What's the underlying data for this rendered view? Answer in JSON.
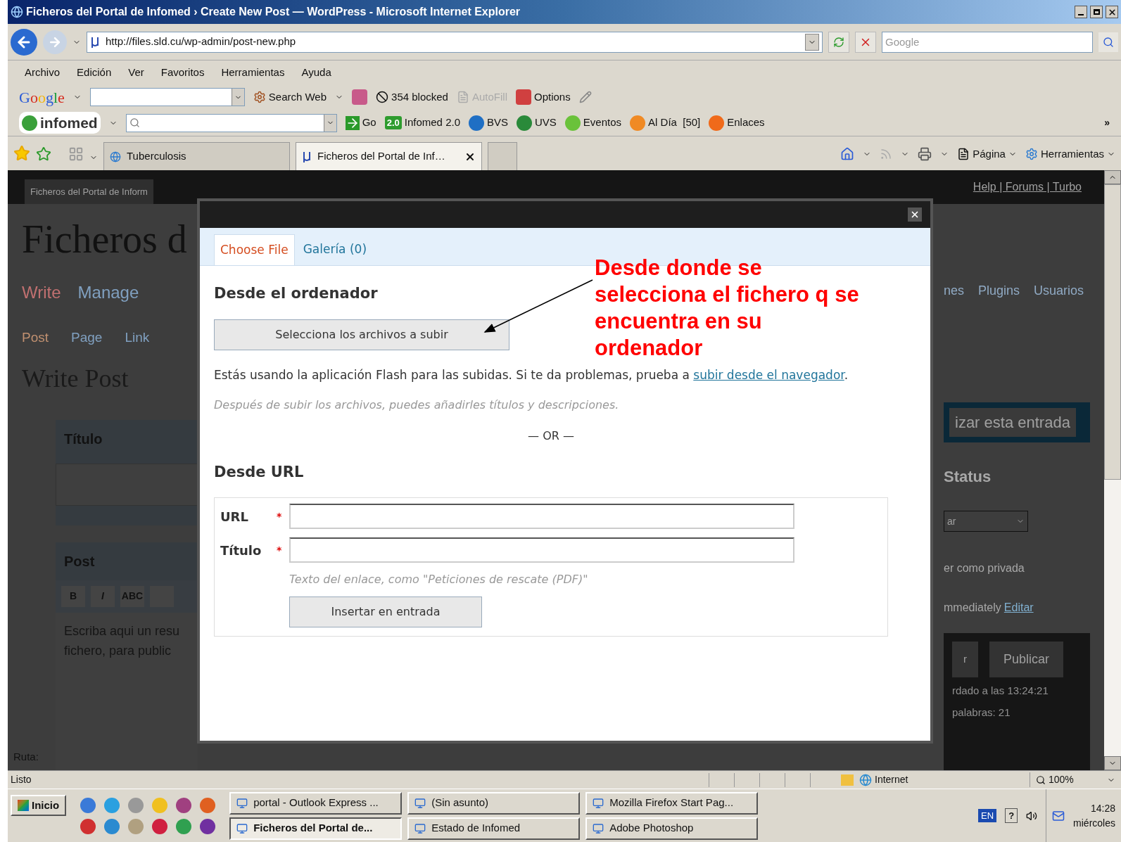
{
  "window": {
    "title": "Ficheros del Portal de Infomed › Create New Post — WordPress - Microsoft Internet Explorer"
  },
  "address_bar": {
    "url": "http://files.sld.cu/wp-admin/post-new.php",
    "search_placeholder": "Google"
  },
  "menu": [
    "Archivo",
    "Edición",
    "Ver",
    "Favoritos",
    "Herramientas",
    "Ayuda"
  ],
  "google_toolbar": {
    "logo": "Google",
    "search_button": "Search Web",
    "blocked": "354 blocked",
    "autofill": {
      "label": "AutoFill",
      "disabled": true
    },
    "options": "Options"
  },
  "links_toolbar": {
    "logo": "infomed",
    "go": "Go",
    "items": [
      {
        "badge": "2.0",
        "label": "Infomed 2.0",
        "color": "#2e9c2e"
      },
      {
        "label": "BVS",
        "color": "#1f6fc4"
      },
      {
        "label": "UVS",
        "color": "#2a8a3a"
      },
      {
        "label": "Eventos",
        "color": "#6ac23a"
      },
      {
        "label": "Al Día  [50]",
        "color": "#f08a24"
      },
      {
        "label": "Enlaces",
        "color": "#f06a1a"
      }
    ],
    "more": "»"
  },
  "tabs": [
    {
      "label": "Tuberculosis",
      "selected": false
    },
    {
      "label": "Ficheros del Portal de Inf…",
      "selected": true
    }
  ],
  "command_bar": [
    "Página",
    "Herramientas"
  ],
  "page": {
    "site_tab": "Ficheros del Portal de Inform",
    "site_title": "Ficheros d",
    "top_links": "Help | Forums | Turbo",
    "nav": [
      {
        "label": "Write",
        "selected": true
      },
      {
        "label": "Manage",
        "selected": false
      }
    ],
    "subnav": [
      {
        "label": "Post",
        "selected": true
      },
      {
        "label": "Page",
        "selected": false
      },
      {
        "label": "Link",
        "selected": false
      }
    ],
    "heading": "Write Post",
    "title_label": "Título",
    "post_label": "Post",
    "editor_buttons": [
      "B",
      "I",
      "ABC"
    ],
    "editor_text": [
      "Escriba aqui un resu",
      "fichero, para public"
    ],
    "path_label": "Ruta:",
    "right_nav": [
      "nes",
      "Plugins",
      "Usuarios"
    ],
    "preview": "izar esta entrada",
    "status_title": "Status",
    "status_select": "ar",
    "private_text": "er como privada",
    "publish_text": "mmediately",
    "edit_link": "Editar",
    "save_button": "r",
    "publish_button": "Publicar",
    "saved_text": "rdado a las 13:24:21",
    "words_text": "palabras: 21"
  },
  "dialog": {
    "tabs": [
      {
        "label": "Choose File",
        "selected": true
      },
      {
        "label": "Galería (0)",
        "selected": false
      }
    ],
    "section1": "Desde el ordenador",
    "upload_button": "Selecciona los archivos a subir",
    "notice": {
      "text": "Estás usando la aplicación Flash para las subidas. Si te da problemas, prueba a ",
      "link": "subir desde el navegador",
      "end": "."
    },
    "hint": "Después de subir los archivos, puedes añadirles títulos y descripciones.",
    "or": "— OR —",
    "section2": "Desde URL",
    "fields": [
      {
        "label": "URL",
        "mark": "*"
      },
      {
        "label": "Título",
        "mark": "*"
      }
    ],
    "field_hint": "Texto del enlace, como \"Peticiones de rescate (PDF)\"",
    "insert_button": "Insertar en entrada"
  },
  "annotation": [
    "Desde donde se",
    "selecciona el fichero q se",
    "encuentra en su",
    "ordenador"
  ],
  "status_bar": {
    "text": "Listo",
    "zone": "Internet",
    "zoom": "100%"
  },
  "taskbar": {
    "start": "Inicio",
    "windows": [
      {
        "label": "portal - Outlook Express ...",
        "selected": false
      },
      {
        "label": "(Sin asunto)",
        "selected": false
      },
      {
        "label": "Mozilla Firefox Start Pag...",
        "selected": false
      },
      {
        "label": "Ficheros del Portal de...",
        "selected": true
      },
      {
        "label": "Estado de Infomed",
        "selected": false
      },
      {
        "label": "Adobe Photoshop",
        "selected": false
      }
    ],
    "language": "EN",
    "help": "?",
    "time": "14:28",
    "day": "miércoles"
  }
}
